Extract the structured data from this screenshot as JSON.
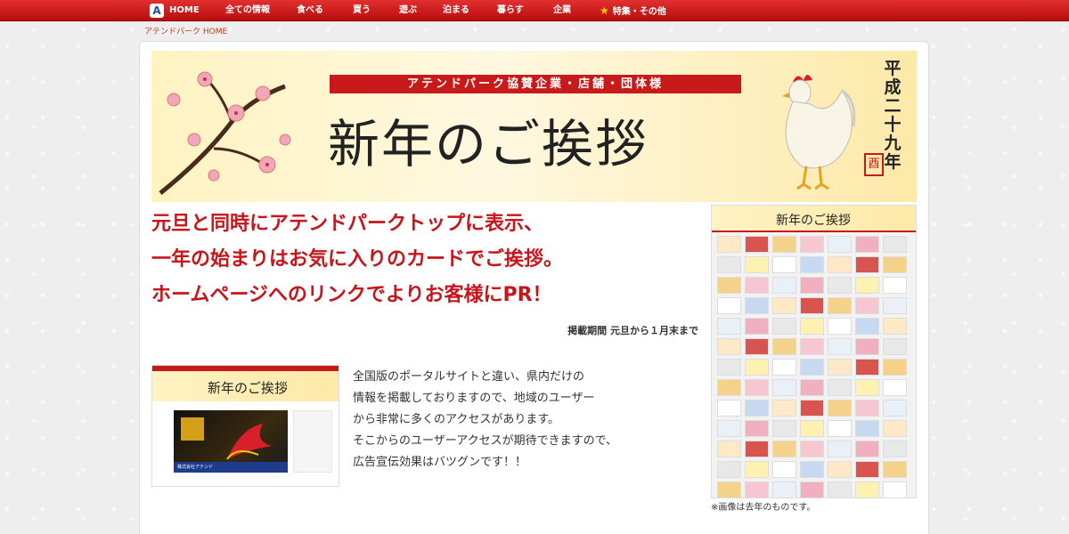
{
  "nav": {
    "logo": "A",
    "items": [
      "HOME",
      "全ての情報",
      "食べる",
      "買う",
      "遊ぶ",
      "泊まる",
      "暮らす",
      "企業",
      "特集・その他"
    ]
  },
  "breadcrumb": "アテンドパーク HOME",
  "banner": {
    "ribbon": "アテンドパーク協賛企業・店舗・団体様",
    "title": "新年のご挨拶",
    "year": "平成二十九年",
    "seal": "酉"
  },
  "headline": {
    "line1": "元旦と同時にアテンドパークトップに表示、",
    "line2": "一年の始まりはお気に入りのカードでご挨拶。",
    "line3": "ホームページへのリンクでよりお客様にPR！"
  },
  "period": "掲載期間 元旦から１月末まで",
  "thumb": {
    "title": "新年のご挨拶",
    "company": "株式会社アテンド"
  },
  "body_text": {
    "line1": "全国版のポータルサイトと違い、県内だけの",
    "line2": "情報を掲載しておりますので、地域のユーザー",
    "line3": "から非常に多くのアクセスがあります。",
    "line4": "そこからのユーザーアクセスが期待できますので、",
    "line5": "広告宣伝効果はバツグンです！！"
  },
  "preview": {
    "title": "新年のご挨拶"
  },
  "caption": "※画像は去年のものです。",
  "colors": {
    "nav_red": "#c81a1a",
    "headline_red": "#c8141a",
    "banner_gold": "#fde9a8"
  }
}
